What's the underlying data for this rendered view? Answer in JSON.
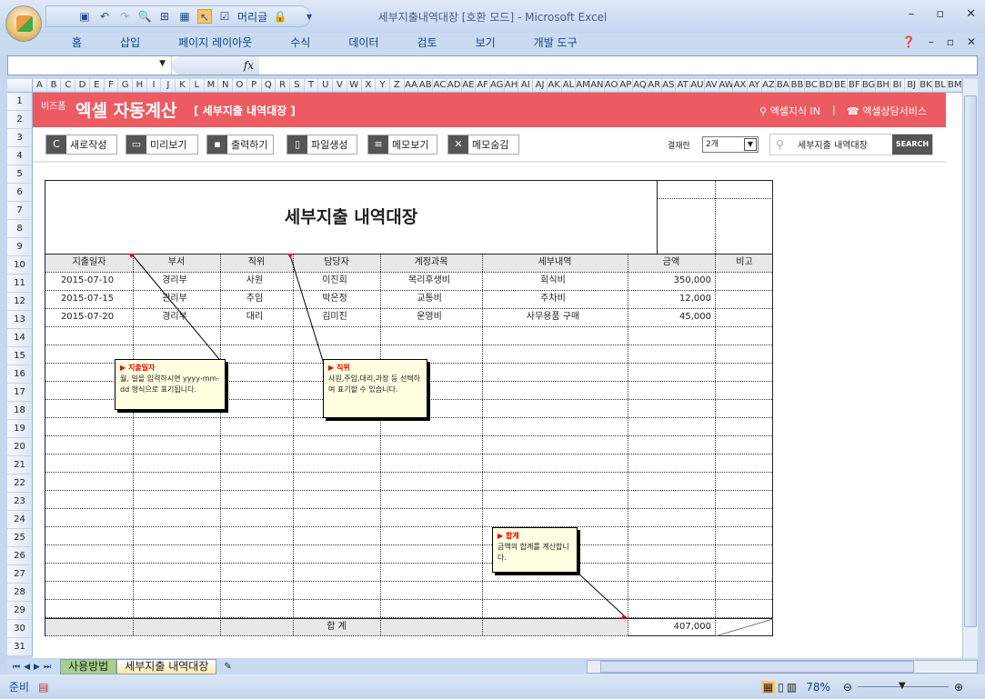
{
  "window": {
    "title": "세부지출내역대장  [호환 모드] - Microsoft Excel",
    "qat_label": "머리글"
  },
  "ribbon": {
    "tabs": [
      "홈",
      "삽입",
      "페이지 레이아웃",
      "수식",
      "데이터",
      "검토",
      "보기",
      "개발 도구"
    ]
  },
  "formula": {
    "fx": "fx",
    "name_box": "",
    "value": ""
  },
  "columns": [
    "A",
    "B",
    "C",
    "D",
    "E",
    "F",
    "G",
    "H",
    "I",
    "J",
    "K",
    "L",
    "M",
    "N",
    "O",
    "P",
    "Q",
    "R",
    "S",
    "T",
    "U",
    "V",
    "W",
    "X",
    "Y",
    "Z",
    "AA",
    "AB",
    "AC",
    "AD",
    "AE",
    "AF",
    "AG",
    "AH",
    "AI",
    "AJ",
    "AK",
    "AL",
    "AM",
    "AN",
    "AO",
    "AP",
    "AQ",
    "AR",
    "AS",
    "AT",
    "AU",
    "AV",
    "AW",
    "AX",
    "AY",
    "AZ",
    "BA",
    "BB",
    "BC",
    "BD",
    "BE",
    "BF",
    "BG",
    "BH",
    "BI",
    "BJ",
    "BK",
    "BL",
    "BM"
  ],
  "banner": {
    "brand": "비즈폼",
    "title": "엑셀 자동계산",
    "subtitle": "[ 세부지출 내역대장 ]",
    "link1": "엑셀지식 IN",
    "sep": "|",
    "link2": "엑셀상담서비스"
  },
  "toolbar": {
    "buttons": [
      "새로작성",
      "미리보기",
      "출력하기",
      "파일생성",
      "메모보기",
      "메모숨김"
    ],
    "approval_label": "결재란",
    "approval_value": "2개",
    "search_value": "세부지출 내역대장",
    "search_button": "SEARCH"
  },
  "ledger": {
    "title": "세부지출 내역대장",
    "headers": [
      "지출일자",
      "부서",
      "직위",
      "담당자",
      "계정과목",
      "세부내역",
      "금액",
      "비고"
    ],
    "rows": [
      [
        "2015-07-10",
        "경리부",
        "사원",
        "이진희",
        "복리후생비",
        "회식비",
        "350,000",
        ""
      ],
      [
        "2015-07-15",
        "관리부",
        "주임",
        "박은정",
        "교통비",
        "주차비",
        "12,000",
        ""
      ],
      [
        "2015-07-20",
        "경리부",
        "대리",
        "김미진",
        "운영비",
        "사무용품 구매",
        "45,000",
        ""
      ]
    ],
    "total_label": "합      계",
    "total_value": "407,000"
  },
  "memos": [
    {
      "title": "지출일자",
      "body": "월, 일을 입력하시면 yyyy-mm-dd 형식으로 표기됩니다."
    },
    {
      "title": "직위",
      "body": "사원,주임,대리,과장 등 선택하여 표기할 수 있습니다."
    },
    {
      "title": "합계",
      "body": "금액의 합계를 계산합니다."
    }
  ],
  "sheets": {
    "tabs": [
      "사용방법",
      "세부지출 내역대장"
    ],
    "active": 1
  },
  "status": {
    "ready": "준비",
    "zoom": "78%"
  }
}
